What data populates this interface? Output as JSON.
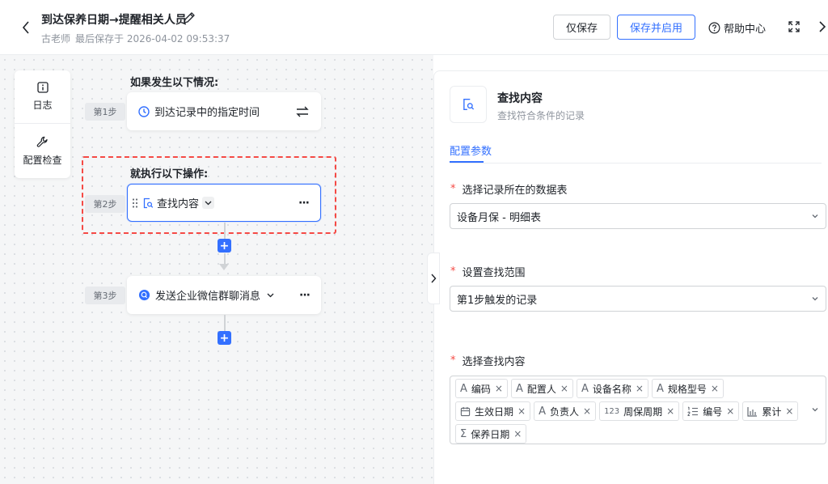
{
  "header": {
    "title": "到达保养日期→提醒相关人员",
    "author": "古老师",
    "saved_text": "最后保存于 2026-04-02 09:53:37",
    "save_label": "仅保存",
    "save_enable_label": "保存并启用",
    "help_label": "帮助中心"
  },
  "side_tools": {
    "log_label": "日志",
    "check_label": "配置检查"
  },
  "flow": {
    "trigger_heading": "如果发生以下情况:",
    "action_heading": "就执行以下操作:",
    "steps": [
      {
        "badge": "第1步",
        "label": "到达记录中的指定时间"
      },
      {
        "badge": "第2步",
        "label": "查找内容"
      },
      {
        "badge": "第3步",
        "label": "发送企业微信群聊消息"
      }
    ],
    "plus_symbol": "+",
    "more_symbol": "···"
  },
  "panel": {
    "title": "查找内容",
    "description": "查找符合条件的记录",
    "tab_label": "配置参数",
    "required_mark": "*",
    "table_label": "选择记录所在的数据表",
    "table_value": "设备月保 - 明细表",
    "scope_label": "设置查找范围",
    "scope_value": "第1步触发的记录",
    "content_label": "选择查找内容",
    "tags": [
      {
        "icon": "A",
        "label": "编码"
      },
      {
        "icon": "A",
        "label": "配置人"
      },
      {
        "icon": "A",
        "label": "设备名称"
      },
      {
        "icon": "A",
        "label": "规格型号"
      },
      {
        "icon": "calendar",
        "label": "生效日期"
      },
      {
        "icon": "A",
        "label": "负责人"
      },
      {
        "icon": "123",
        "label": "周保周期"
      },
      {
        "icon": "ordered-list",
        "label": "编号"
      },
      {
        "icon": "bar-chart",
        "label": "累计"
      },
      {
        "icon": "Σ",
        "label": "保养日期"
      }
    ],
    "tag_remove": "×"
  },
  "colors": {
    "primary": "#3370ff",
    "danger": "#f54a45",
    "text": "#1f2329",
    "muted": "#8f959e"
  }
}
